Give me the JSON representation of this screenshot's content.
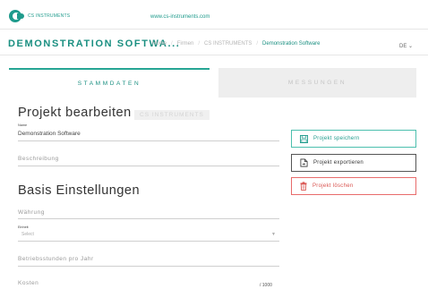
{
  "topbar": {
    "logo_text": "CS INSTRUMENTS",
    "url": "www.cs-instruments.com",
    "brand_color": "#1f9b8c"
  },
  "navbar": {
    "brand": "DEMONSTRATION SOFTWA...",
    "breadcrumbs": [
      "Home",
      "Firmen",
      "CS INSTRUMENTS",
      "Demonstration Software"
    ],
    "language": "DE ⌄"
  },
  "tabs": [
    {
      "label": "STAMMDATEN",
      "active": true
    },
    {
      "label": "MESSUNGEN",
      "active": false
    }
  ],
  "project": {
    "heading": "Projekt bearbeiten",
    "company_tag": "CS INSTRUMENTS",
    "name_label": "Name",
    "name_value": "Demonstration Software",
    "description_placeholder": "Beschreibung"
  },
  "basis": {
    "heading": "Basis Einstellungen",
    "currency_placeholder": "Währung",
    "unit_label": "Einheit",
    "unit_placeholder": "Select",
    "hours_placeholder": "Betriebsstunden pro Jahr",
    "cost_placeholder": "Kosten",
    "cost_suffix": "/ 1000"
  },
  "actions": {
    "save": "Projekt speichern",
    "export": "Projekt exportieren",
    "delete": "Projekt löschen",
    "save_color": "#1f9b8c",
    "delete_color": "#d9534f"
  }
}
